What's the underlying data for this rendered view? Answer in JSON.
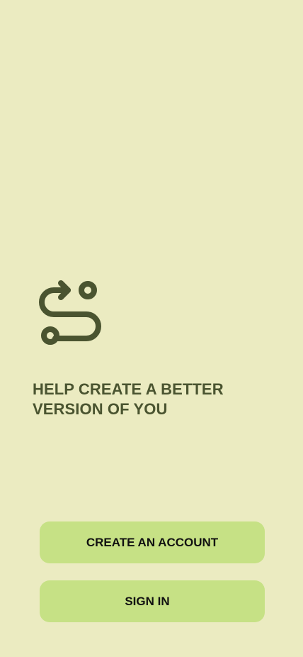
{
  "app": {
    "logo_icon": "route-icon",
    "tagline": "HELP CREATE A BETTER VERSION OF YOU"
  },
  "actions": {
    "create_account_label": "CREATE AN ACCOUNT",
    "sign_in_label": "SIGN IN"
  },
  "colors": {
    "background": "#ebebc1",
    "primary_dark": "#4a5430",
    "button": "#c6e185"
  }
}
